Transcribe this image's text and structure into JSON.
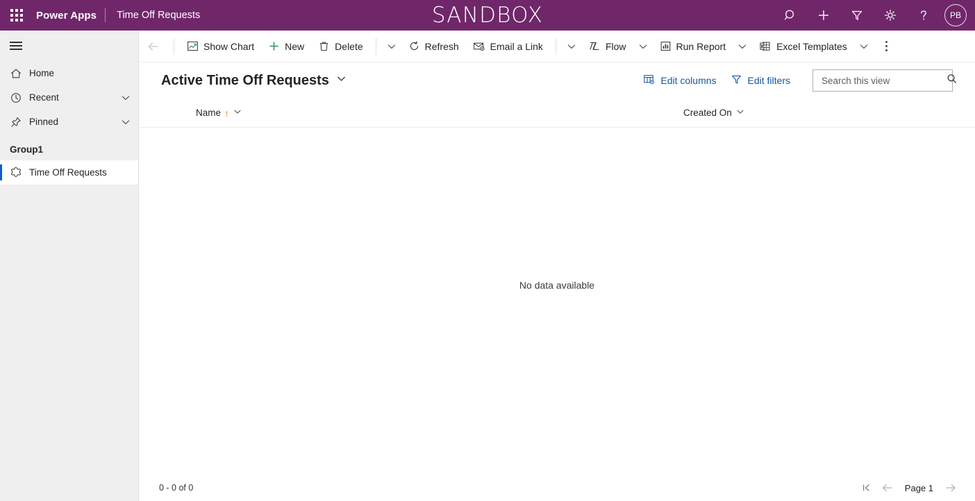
{
  "topbar": {
    "waffle_label": "app-launcher",
    "brand": "Power Apps",
    "app_name": "Time Off Requests",
    "environment_title": "SANDBOX",
    "icons": [
      "search-icon",
      "plus-icon",
      "filter-icon",
      "gear-icon",
      "help-icon"
    ],
    "avatar_initials": "PB",
    "background_color": "#70276a"
  },
  "sidebar": {
    "hamburger_label": "site-map-toggle",
    "items": [
      {
        "label": "Home",
        "icon": "home-icon",
        "expandable": false
      },
      {
        "label": "Recent",
        "icon": "clock-icon",
        "expandable": true
      },
      {
        "label": "Pinned",
        "icon": "pin-icon",
        "expandable": true
      }
    ],
    "group_label": "Group1",
    "entity": {
      "label": "Time Off Requests",
      "icon": "entity-icon",
      "selected": true
    },
    "background_color": "#efefef",
    "selection_color": "#0b5fcc"
  },
  "commandbar": {
    "back_label": "back-arrow",
    "commands": [
      {
        "label": "Show Chart",
        "icon": "chart-icon",
        "has_chevron": false
      },
      {
        "label": "New",
        "icon": "plus-icon",
        "has_chevron": false
      },
      {
        "label": "Delete",
        "icon": "trash-icon",
        "has_chevron": true
      },
      {
        "label": "Refresh",
        "icon": "refresh-icon",
        "has_chevron": false
      },
      {
        "label": "Email a Link",
        "icon": "email-link-icon",
        "has_chevron": true
      },
      {
        "label": "Flow",
        "icon": "flow-icon",
        "has_chevron": true
      },
      {
        "label": "Run Report",
        "icon": "report-icon",
        "has_chevron": true
      },
      {
        "label": "Excel Templates",
        "icon": "excel-icon",
        "has_chevron": true
      }
    ],
    "overflow_label": "more-commands"
  },
  "view": {
    "title": "Active Time Off Requests",
    "edit_columns_label": "Edit columns",
    "edit_filters_label": "Edit filters",
    "link_color": "#16569f",
    "search": {
      "placeholder": "Search this view",
      "value": ""
    }
  },
  "grid": {
    "columns": [
      {
        "label": "Name",
        "sort": "ascending",
        "sort_glyph": "↑"
      },
      {
        "label": "Created On",
        "sort": "none"
      }
    ],
    "rows": [],
    "empty_message": "No data available"
  },
  "footer": {
    "record_count": "0 - 0 of 0",
    "first_page_label": "first-page",
    "previous_page_label": "previous-page",
    "page_label": "Page 1",
    "next_page_label": "next-page"
  }
}
